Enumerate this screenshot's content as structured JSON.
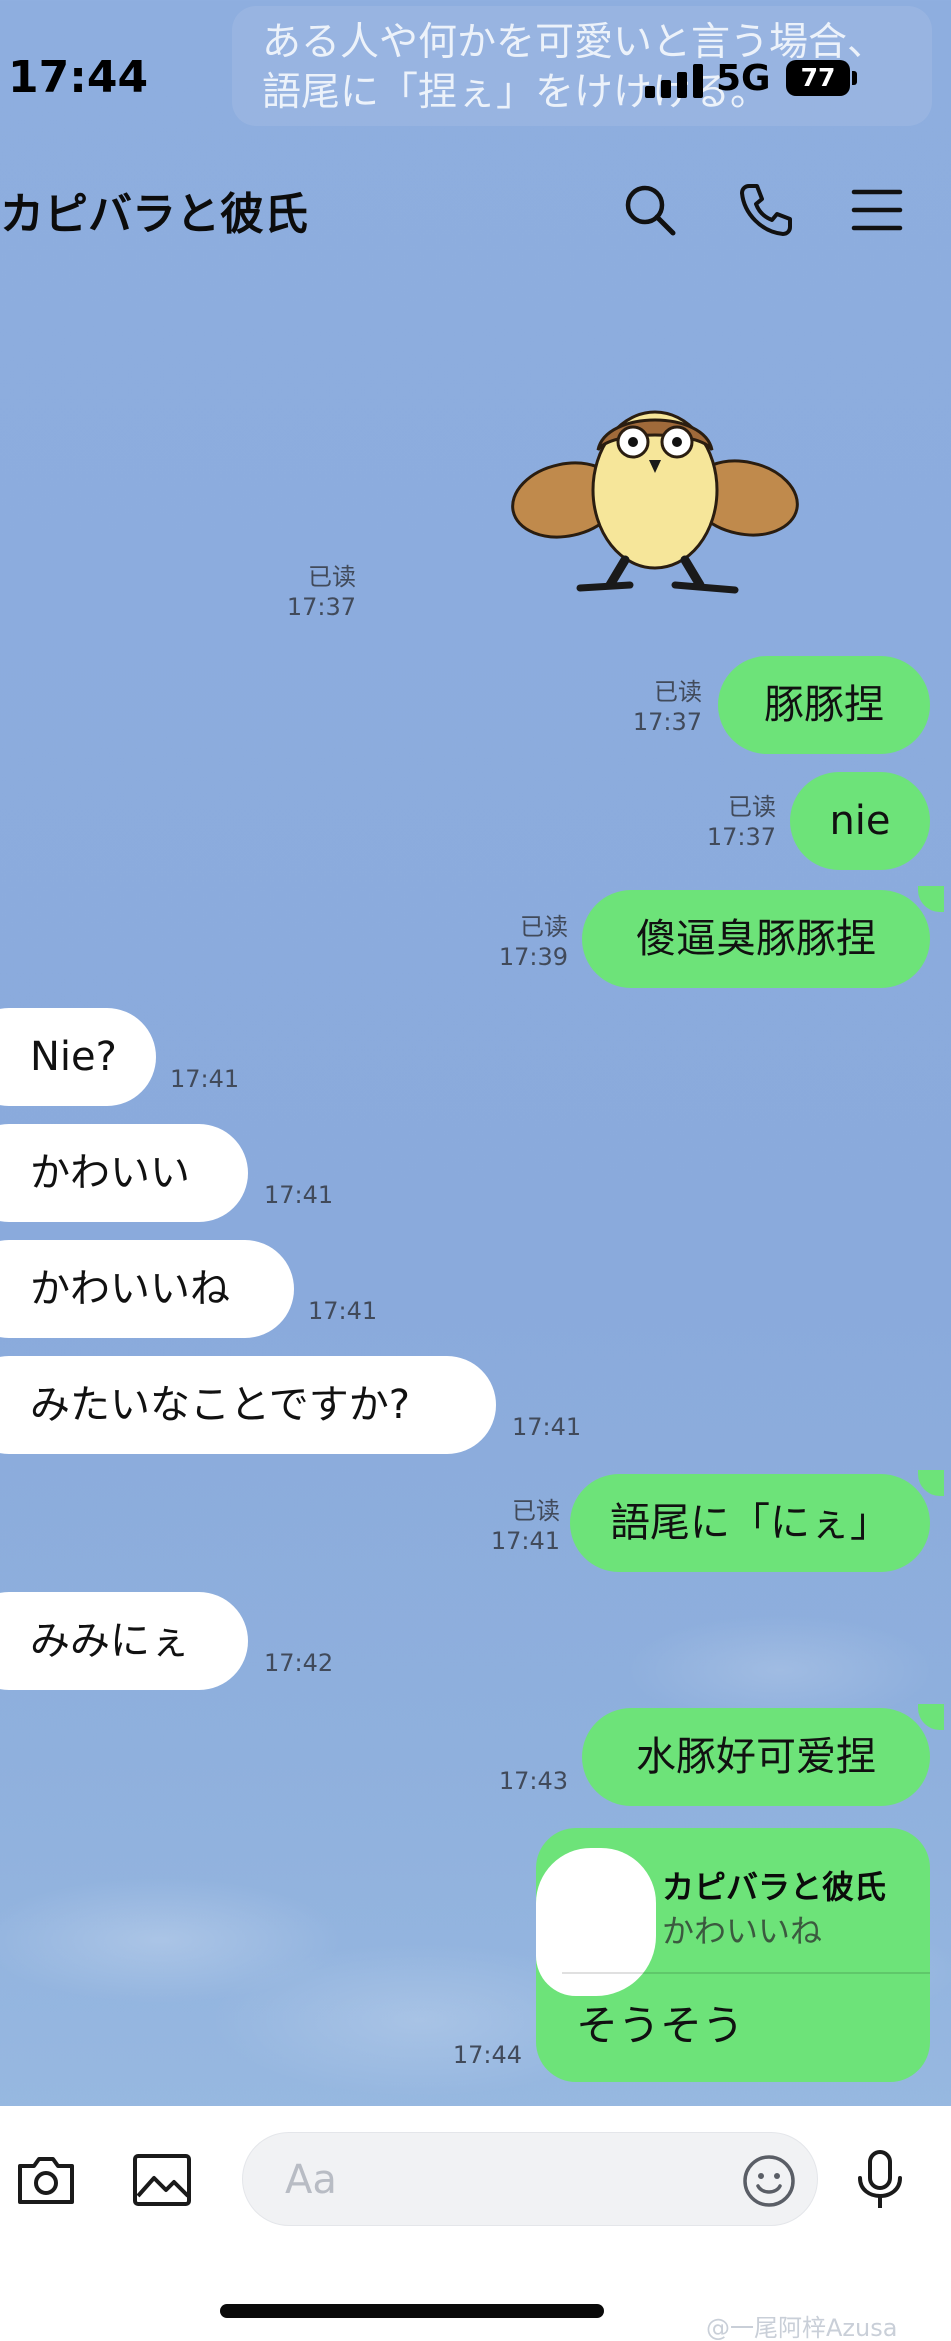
{
  "status_bar": {
    "time": "17:44",
    "network": "5G",
    "battery": "77"
  },
  "notification": {
    "text": "ある人や何かを可愛いと言う場合、語尾に「捏ぇ」をけけける。"
  },
  "header": {
    "title": "カピバラと彼氏",
    "icons": [
      "search-icon",
      "phone-icon",
      "menu-icon"
    ]
  },
  "messages": [
    {
      "type": "sticker",
      "direction": "out",
      "read": "已读",
      "time": "17:37",
      "sticker": "sparrow-sticker"
    },
    {
      "direction": "out",
      "text": "豚豚捏",
      "read": "已读",
      "time": "17:37"
    },
    {
      "direction": "out",
      "text": "nie",
      "read": "已读",
      "time": "17:37"
    },
    {
      "direction": "out",
      "text": "傻逼臭豚豚捏",
      "read": "已读",
      "time": "17:39"
    },
    {
      "direction": "in",
      "text": "Nie?",
      "time": "17:41"
    },
    {
      "direction": "in",
      "text": "かわいい",
      "time": "17:41"
    },
    {
      "direction": "in",
      "text": "かわいいね",
      "time": "17:41"
    },
    {
      "direction": "in",
      "text": "みたいなことですか?",
      "time": "17:41"
    },
    {
      "direction": "out",
      "text": "語尾に「にぇ」",
      "read": "已读",
      "time": "17:41"
    },
    {
      "direction": "in",
      "text": "みみにぇ",
      "time": "17:42"
    },
    {
      "direction": "out",
      "text": "水豚好可爱捏",
      "time": "17:43"
    },
    {
      "direction": "out",
      "type": "reply",
      "reply_to_name": "カピバラと彼氏",
      "reply_to_text": "かわいいね",
      "text": "そうそう",
      "time": "17:44"
    }
  ],
  "input_bar": {
    "placeholder": "Aa",
    "icons": [
      "camera-icon",
      "image-icon",
      "emoji-icon",
      "mic-icon"
    ]
  },
  "watermark": "@一尾阿梓Azusa",
  "colors": {
    "background": "#8aaadc",
    "outgoing_bubble": "#6de379",
    "incoming_bubble": "#ffffff"
  }
}
